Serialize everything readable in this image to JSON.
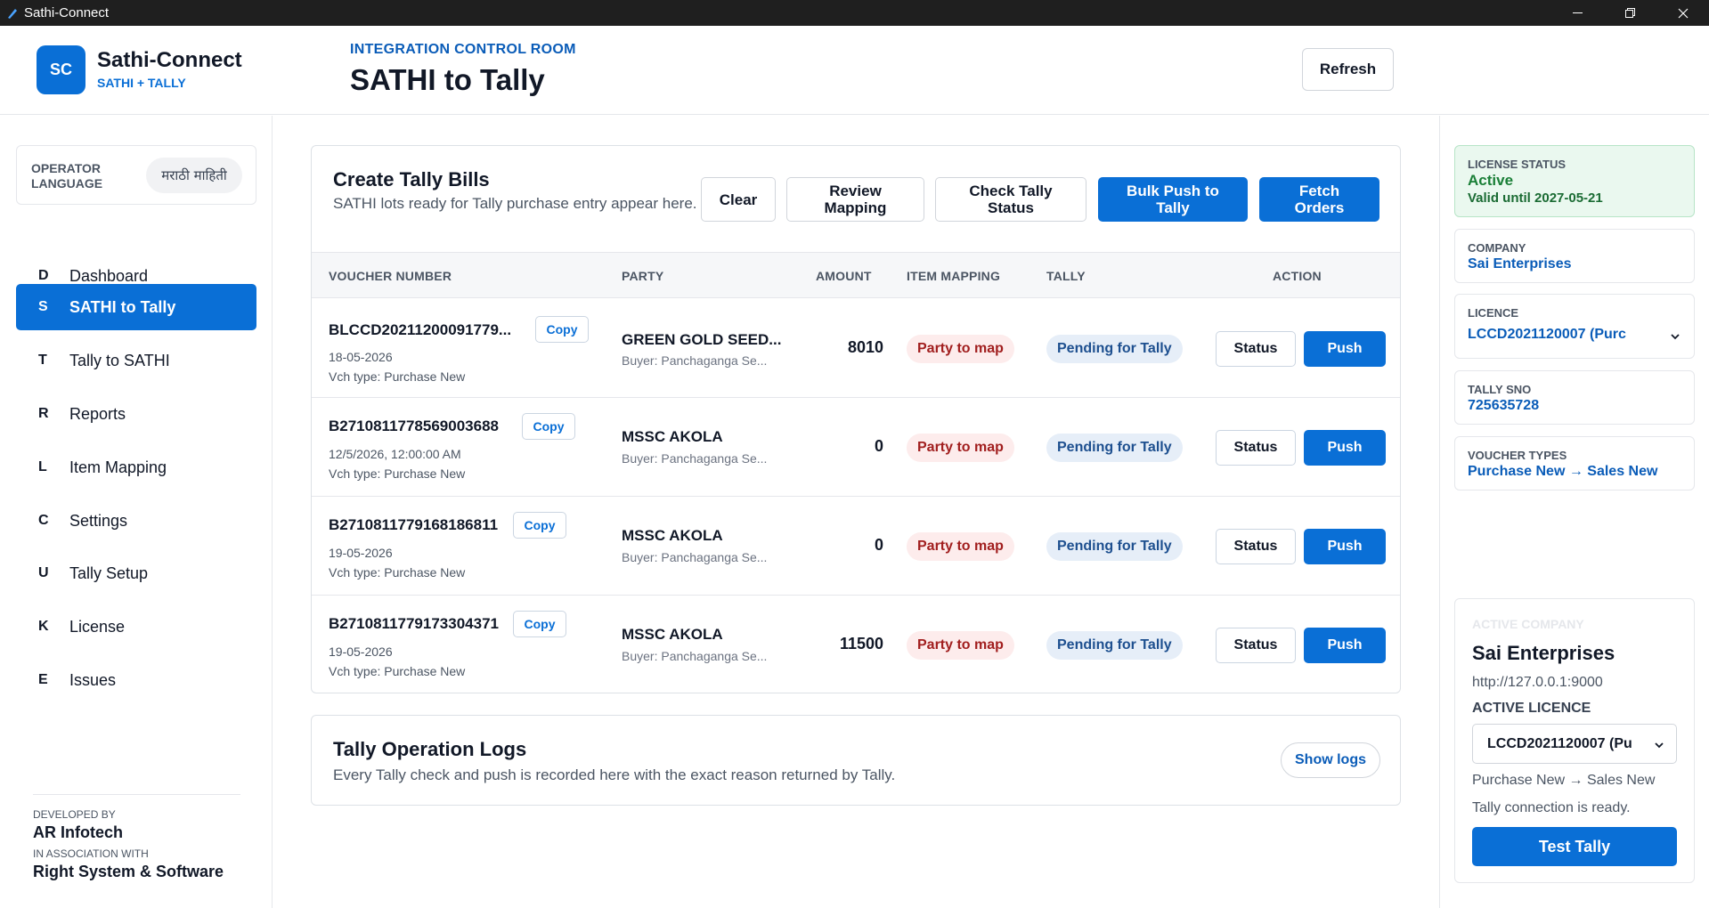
{
  "window": {
    "title": "Sathi-Connect",
    "app_icon": "pen-icon"
  },
  "brand": {
    "logo_text": "SC",
    "name": "Sathi-Connect",
    "subtitle": "SATHI + TALLY"
  },
  "header": {
    "eyebrow": "INTEGRATION CONTROL ROOM",
    "title": "SATHI to Tally",
    "refresh_label": "Refresh"
  },
  "sidebar": {
    "operator_language_label": "OPERATOR LANGUAGE",
    "language_button": "मराठी माहिती",
    "items": [
      {
        "letter": "D",
        "label": "Dashboard",
        "active": false
      },
      {
        "letter": "S",
        "label": "SATHI to Tally",
        "active": true
      },
      {
        "letter": "T",
        "label": "Tally to SATHI",
        "active": false
      },
      {
        "letter": "R",
        "label": "Reports",
        "active": false
      },
      {
        "letter": "L",
        "label": "Item Mapping",
        "active": false
      },
      {
        "letter": "C",
        "label": "Settings",
        "active": false
      },
      {
        "letter": "U",
        "label": "Tally Setup",
        "active": false
      },
      {
        "letter": "K",
        "label": "License",
        "active": false
      },
      {
        "letter": "E",
        "label": "Issues",
        "active": false
      }
    ],
    "developed_by_label": "DEVELOPED BY",
    "developer": "AR Infotech",
    "association_label": "IN ASSOCIATION WITH",
    "partner": "Right System & Software"
  },
  "bills": {
    "title": "Create Tally Bills",
    "subtitle": "SATHI lots ready for Tally purchase entry appear here.",
    "buttons": {
      "clear": "Clear",
      "review_mapping": "Review Mapping",
      "check_status": "Check Tally Status",
      "bulk_push": "Bulk Push to Tally",
      "fetch_orders": "Fetch Orders"
    },
    "columns": {
      "voucher": "VOUCHER NUMBER",
      "party": "PARTY",
      "amount": "AMOUNT",
      "item_mapping": "ITEM MAPPING",
      "tally": "TALLY",
      "action": "ACTION"
    },
    "copy_label": "Copy",
    "status_label": "Status",
    "push_label": "Push",
    "rows": [
      {
        "voucher": "BLCCD20211200091779...",
        "date": "18-05-2026",
        "vch_type": "Vch type: Purchase New",
        "party": "GREEN GOLD SEED...",
        "buyer": "Buyer: Panchaganga Se...",
        "amount": "8010",
        "mapping": "Party to map",
        "tally": "Pending for Tally"
      },
      {
        "voucher": "B2710811778569003688",
        "date": "12/5/2026, 12:00:00 AM",
        "vch_type": "Vch type: Purchase New",
        "party": "MSSC AKOLA",
        "buyer": "Buyer: Panchaganga Se...",
        "amount": "0",
        "mapping": "Party to map",
        "tally": "Pending for Tally"
      },
      {
        "voucher": "B2710811779168186811",
        "date": "19-05-2026",
        "vch_type": "Vch type: Purchase New",
        "party": "MSSC AKOLA",
        "buyer": "Buyer: Panchaganga Se...",
        "amount": "0",
        "mapping": "Party to map",
        "tally": "Pending for Tally"
      },
      {
        "voucher": "B2710811779173304371",
        "date": "19-05-2026",
        "vch_type": "Vch type: Purchase New",
        "party": "MSSC AKOLA",
        "buyer": "Buyer: Panchaganga Se...",
        "amount": "11500",
        "mapping": "Party to map",
        "tally": "Pending for Tally"
      }
    ]
  },
  "logs": {
    "title": "Tally Operation Logs",
    "subtitle": "Every Tally check and push is recorded here with the exact reason returned by Tally.",
    "button": "Show logs"
  },
  "right_panel": {
    "license_status_label": "LICENSE STATUS",
    "license_status": "Active",
    "license_valid": "Valid until 2027-05-21",
    "company_label": "COMPANY",
    "company": "Sai Enterprises",
    "licence_label": "LICENCE",
    "licence_value": "LCCD2021120007 (Purc",
    "tally_sno_label": "TALLY SNO",
    "tally_sno": "725635728",
    "voucher_types_label": "VOUCHER TYPES",
    "voucher_types": "Purchase New → Sales New",
    "active_company": {
      "eyebrow": "ACTIVE COMPANY",
      "name": "Sai Enterprises",
      "url": "http://127.0.0.1:9000",
      "licence_label": "ACTIVE LICENCE",
      "licence_value": "LCCD2021120007 (Pu",
      "voucher_types": "Purchase New → Sales New",
      "connection_status": "Tally connection is ready.",
      "test_button": "Test Tally"
    }
  },
  "colors": {
    "primary": "#0a6fd6",
    "danger_pill_bg": "#fdecec",
    "info_pill_bg": "#e6eef8",
    "success_bg": "#eaf8ef"
  }
}
